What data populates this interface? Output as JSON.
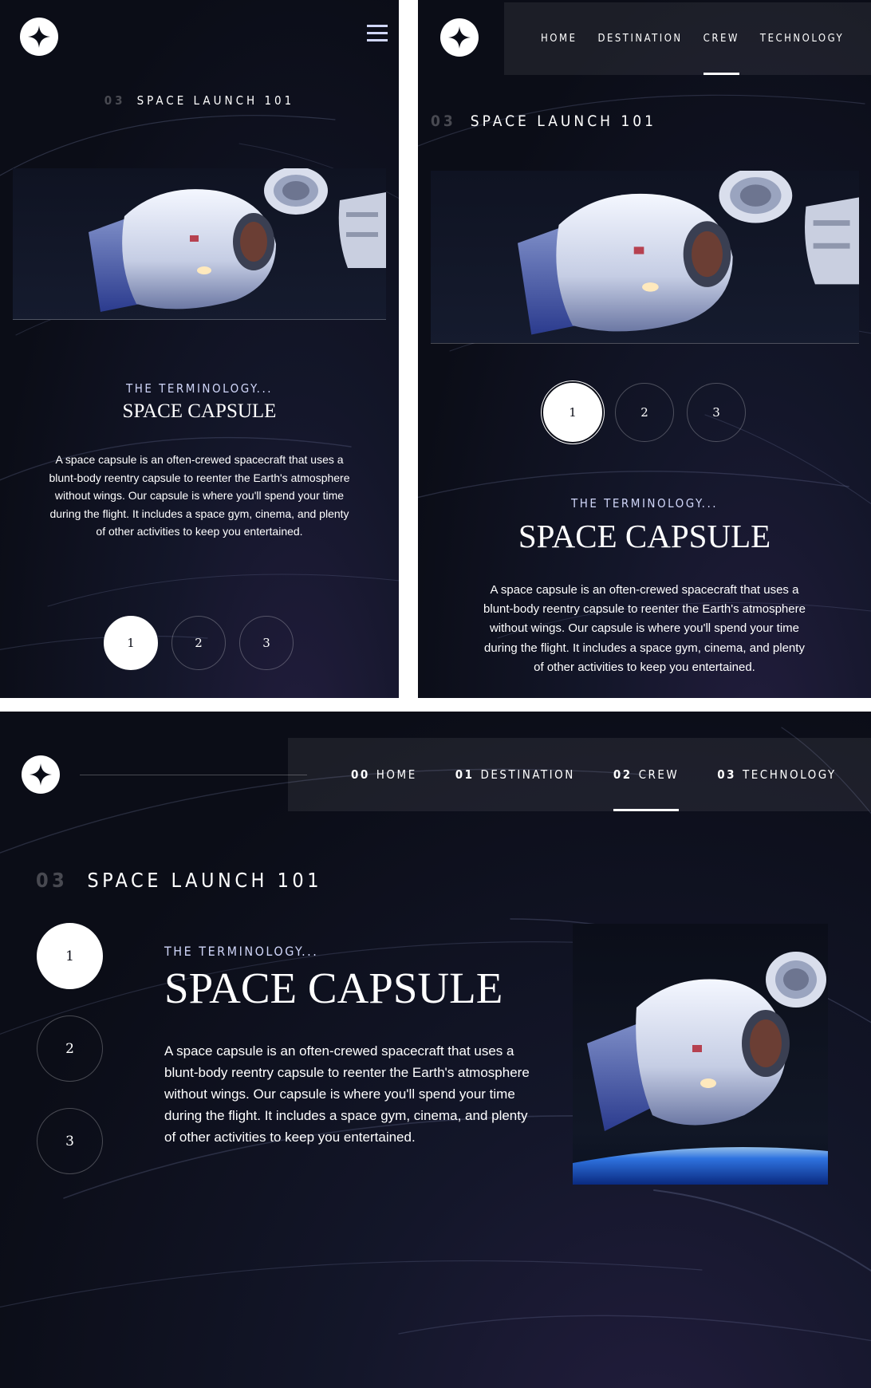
{
  "brand": {
    "logo": "star-logo"
  },
  "nav": [
    {
      "num": "00",
      "label": "HOME"
    },
    {
      "num": "01",
      "label": "DESTINATION"
    },
    {
      "num": "02",
      "label": "CREW",
      "active": true
    },
    {
      "num": "03",
      "label": "TECHNOLOGY"
    }
  ],
  "page": {
    "number": "03",
    "heading": "SPACE LAUNCH 101"
  },
  "tech": {
    "subtitle": "THE TERMINOLOGY...",
    "name": "SPACE CAPSULE",
    "description": "A space capsule is an often-crewed spacecraft that uses a blunt-body reentry capsule to reenter the Earth's atmosphere without wings. Our capsule is where you'll spend your time during the flight. It includes a space gym, cinema, and plenty of other activities to keep you entertained."
  },
  "pager": [
    "1",
    "2",
    "3"
  ],
  "colors": {
    "bg": "#0b0d17",
    "accent": "#d0d6f9",
    "white": "#ffffff"
  }
}
